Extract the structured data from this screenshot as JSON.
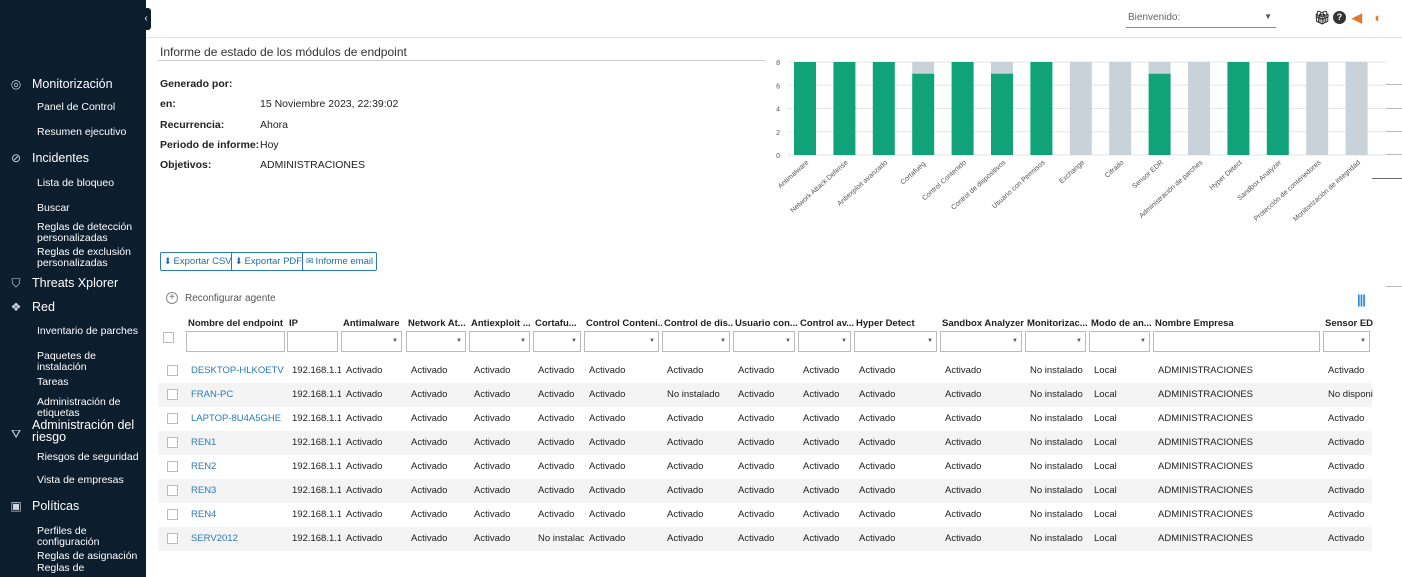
{
  "sidebar": {
    "sections": [
      {
        "label": "Monitorización",
        "icon": "monitoring-icon",
        "items": [
          "Panel de Control",
          "Resumen ejecutivo"
        ]
      },
      {
        "label": "Incidentes",
        "icon": "incidents-icon",
        "items": [
          "Lista de bloqueo",
          "Buscar",
          "Reglas de detección personalizadas",
          "Reglas de exclusión personalizadas"
        ]
      },
      {
        "label": "Threats Xplorer",
        "icon": "shield-icon",
        "items": []
      },
      {
        "label": "Red",
        "icon": "network-icon",
        "items": [
          "Inventario de parches",
          "Paquetes de instalación",
          "Tareas",
          "Administración de etiquetas"
        ]
      },
      {
        "label": "Administración del riesgo",
        "icon": "risk-icon",
        "items": [
          "Riesgos de seguridad",
          "Vista de empresas"
        ]
      },
      {
        "label": "Políticas",
        "icon": "policies-icon",
        "items": [
          "Perfiles de configuración",
          "Reglas de asignación",
          "Reglas de"
        ]
      }
    ]
  },
  "topbar": {
    "welcome": "Bienvenido:",
    "icons": [
      "gift-icon",
      "help-icon",
      "notifications-icon",
      "megaphone-icon"
    ]
  },
  "report": {
    "title": "Informe de estado de los módulos de endpoint",
    "meta": [
      {
        "label": "Generado por:",
        "value": ""
      },
      {
        "label": "en:",
        "value": "15 Noviembre 2023, 22:39:02"
      },
      {
        "label": "Recurrencia:",
        "value": "Ahora"
      },
      {
        "label": "Periodo de informe:",
        "value": "Hoy"
      },
      {
        "label": "Objetivos:",
        "value": "ADMINISTRACIONES"
      }
    ]
  },
  "buttons": {
    "export_csv": "Exportar CSV",
    "export_pdf": "Exportar PDF",
    "email_report": "Informe email",
    "reconfigure": "Reconfigurar agente"
  },
  "chart_data": {
    "type": "bar",
    "stacked": true,
    "categories": [
      "Antimalware",
      "Network Attack Defense",
      "Antiexploit avanzado",
      "Cortafueg.",
      "Control Contenido",
      "Control de dispositivos",
      "Usuario con Permisos",
      "Exchange",
      "Cifrado",
      "Sensor EDR",
      "Administración de parches",
      "Hyper Detect",
      "Sandbox Analyzer",
      "Protección de contenedores",
      "Monitorización de integridad"
    ],
    "series": [
      {
        "values": [
          8,
          8,
          8,
          7,
          8,
          7,
          8,
          0,
          0,
          7,
          0,
          8,
          8,
          0,
          0
        ],
        "color": "#10a37a"
      },
      {
        "values": [
          0,
          0,
          0,
          1,
          0,
          1,
          0,
          8,
          8,
          1,
          8,
          0,
          0,
          8,
          8
        ],
        "color": "#c9d2d8"
      }
    ],
    "ylim": [
      0,
      8
    ],
    "yticks": [
      "0",
      "2",
      "4",
      "6",
      "8"
    ],
    "grid": true
  },
  "table": {
    "columns": [
      "Nombre del endpoint",
      "IP",
      "Antimalware",
      "Network At...",
      "Antiexploit ...",
      "Cortafu...",
      "Control Conteni...",
      "Control de dis...",
      "Usuario con...",
      "Control av...",
      "Hyper Detect",
      "Sandbox Analyzer",
      "Monitorizac...",
      "Modo de an...",
      "Nombre Empresa",
      "Sensor EDR"
    ],
    "rows": [
      [
        "DESKTOP-HLKOETV",
        "192.168.1.1...",
        "Activado",
        "Activado",
        "Activado",
        "Activado",
        "Activado",
        "Activado",
        "Activado",
        "Activado",
        "Activado",
        "Activado",
        "No instalado",
        "Local",
        "ADMINISTRACIONES",
        "Activado"
      ],
      [
        "FRAN-PC",
        "192.168.1.1...",
        "Activado",
        "Activado",
        "Activado",
        "Activado",
        "Activado",
        "No instalado",
        "Activado",
        "Activado",
        "Activado",
        "Activado",
        "No instalado",
        "Local",
        "ADMINISTRACIONES",
        "No disponibl"
      ],
      [
        "LAPTOP-8U4A5GHE",
        "192.168.1.1...",
        "Activado",
        "Activado",
        "Activado",
        "Activado",
        "Activado",
        "Activado",
        "Activado",
        "Activado",
        "Activado",
        "Activado",
        "No instalado",
        "Local",
        "ADMINISTRACIONES",
        "Activado"
      ],
      [
        "REN1",
        "192.168.1.1...",
        "Activado",
        "Activado",
        "Activado",
        "Activado",
        "Activado",
        "Activado",
        "Activado",
        "Activado",
        "Activado",
        "Activado",
        "No instalado",
        "Local",
        "ADMINISTRACIONES",
        "Activado"
      ],
      [
        "REN2",
        "192.168.1.1...",
        "Activado",
        "Activado",
        "Activado",
        "Activado",
        "Activado",
        "Activado",
        "Activado",
        "Activado",
        "Activado",
        "Activado",
        "No instalado",
        "Local",
        "ADMINISTRACIONES",
        "Activado"
      ],
      [
        "REN3",
        "192.168.1.1...",
        "Activado",
        "Activado",
        "Activado",
        "Activado",
        "Activado",
        "Activado",
        "Activado",
        "Activado",
        "Activado",
        "Activado",
        "No instalado",
        "Local",
        "ADMINISTRACIONES",
        "Activado"
      ],
      [
        "REN4",
        "192.168.1.1...",
        "Activado",
        "Activado",
        "Activado",
        "Activado",
        "Activado",
        "Activado",
        "Activado",
        "Activado",
        "Activado",
        "Activado",
        "No instalado",
        "Local",
        "ADMINISTRACIONES",
        "Activado"
      ],
      [
        "SERV2012",
        "192.168.1.1...",
        "Activado",
        "Activado",
        "Activado",
        "No instalado",
        "Activado",
        "Activado",
        "Activado",
        "Activado",
        "Activado",
        "Activado",
        "No instalado",
        "Local",
        "ADMINISTRACIONES",
        "Activado"
      ]
    ]
  }
}
